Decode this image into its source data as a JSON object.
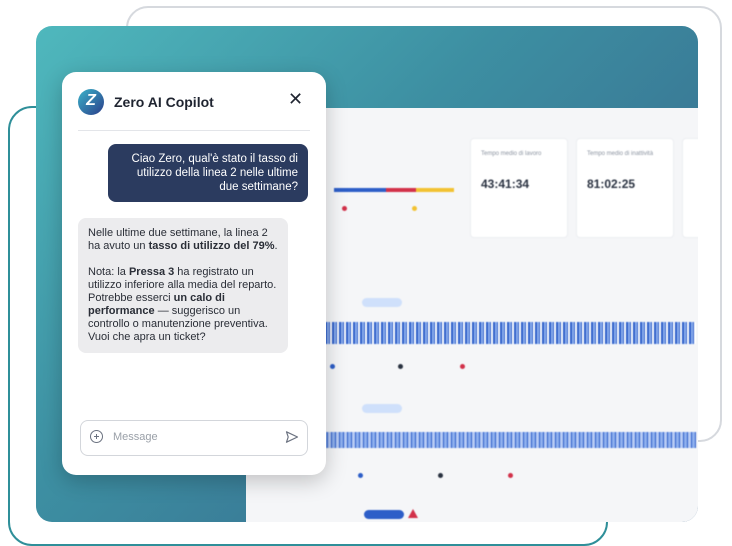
{
  "chat": {
    "title": "Zero AI Copilot",
    "logo_letter": "Z",
    "close_symbol": "✕",
    "user_message": "Ciao Zero, qual'è stato il tasso di utilizzo della linea 2 nelle ultime due settimane?",
    "bot_p1_a": "Nelle ultime due settimane, la linea 2 ha avuto un ",
    "bot_p1_b": "tasso di utilizzo del 79%",
    "bot_p1_c": ".",
    "bot_p2_a": "Nota: la ",
    "bot_p2_b": "Pressa 3",
    "bot_p2_c": " ha registrato un utilizzo inferiore alla media del reparto. Potrebbe esserci ",
    "bot_p2_d": "un calo di performance",
    "bot_p2_e": " — suggerisco un controllo o manutenzione preventiva. Vuoi che apra un ticket?",
    "input_placeholder": "Message",
    "icons": {
      "add": "plus-circle-icon",
      "send": "send-icon",
      "close": "close-icon"
    }
  },
  "dashboard": {
    "stats": [
      {
        "label": "Tempo medio di lavoro",
        "value": "43:41:34"
      },
      {
        "label": "Tempo medio di inattività",
        "value": "81:02:25"
      }
    ],
    "colors": {
      "blue": "#2d5ec8",
      "red": "#d2314a",
      "yellow": "#f2c232",
      "accent_teal": "#3d8fa2"
    }
  }
}
